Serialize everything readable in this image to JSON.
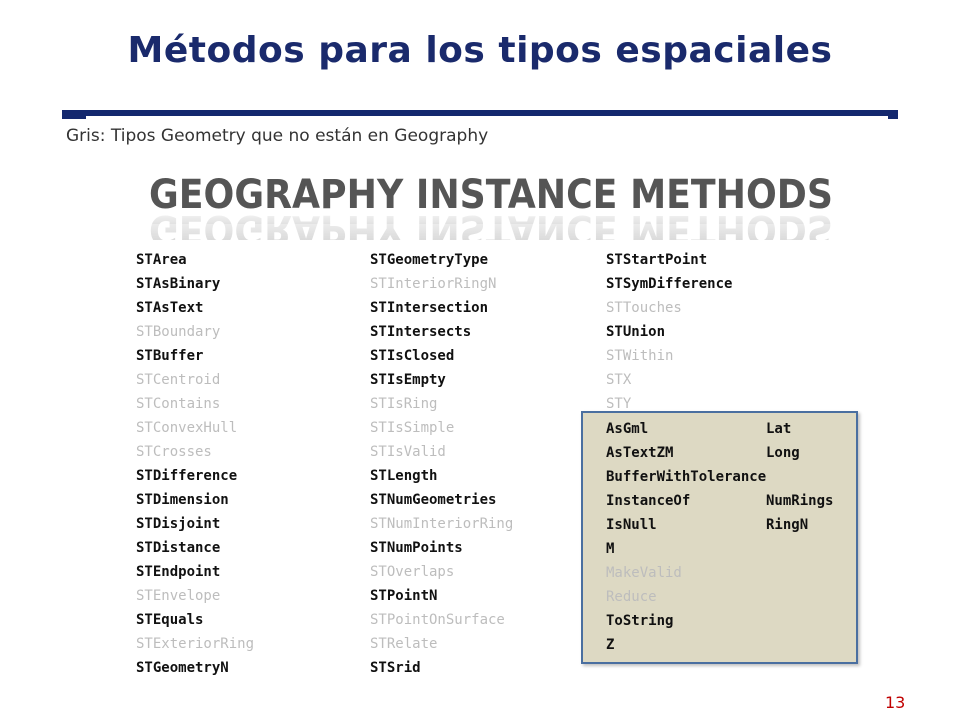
{
  "slide": {
    "title": "Métodos para los tipos espaciales",
    "subtitle": "Gris: Tipos Geometry que no están en Geography",
    "banner_text": "GEOGRAPHY INSTANCE METHODS",
    "page_number": "13"
  },
  "columns": [
    [
      {
        "name": "STArea",
        "supported": true
      },
      {
        "name": "STAsBinary",
        "supported": true
      },
      {
        "name": "STAsText",
        "supported": true
      },
      {
        "name": "STBoundary",
        "supported": false
      },
      {
        "name": "STBuffer",
        "supported": true
      },
      {
        "name": "STCentroid",
        "supported": false
      },
      {
        "name": "STContains",
        "supported": false
      },
      {
        "name": "STConvexHull",
        "supported": false
      },
      {
        "name": "STCrosses",
        "supported": false
      },
      {
        "name": "STDifference",
        "supported": true
      },
      {
        "name": "STDimension",
        "supported": true
      },
      {
        "name": "STDisjoint",
        "supported": true
      },
      {
        "name": "STDistance",
        "supported": true
      },
      {
        "name": "STEndpoint",
        "supported": true
      },
      {
        "name": "STEnvelope",
        "supported": false
      },
      {
        "name": "STEquals",
        "supported": true
      },
      {
        "name": "STExteriorRing",
        "supported": false
      },
      {
        "name": "STGeometryN",
        "supported": true
      }
    ],
    [
      {
        "name": "STGeometryType",
        "supported": true
      },
      {
        "name": "STInteriorRingN",
        "supported": false
      },
      {
        "name": "STIntersection",
        "supported": true
      },
      {
        "name": "STIntersects",
        "supported": true
      },
      {
        "name": "STIsClosed",
        "supported": true
      },
      {
        "name": "STIsEmpty",
        "supported": true
      },
      {
        "name": "STIsRing",
        "supported": false
      },
      {
        "name": "STIsSimple",
        "supported": false
      },
      {
        "name": "STIsValid",
        "supported": false
      },
      {
        "name": "STLength",
        "supported": true
      },
      {
        "name": "STNumGeometries",
        "supported": true
      },
      {
        "name": "STNumInteriorRing",
        "supported": false
      },
      {
        "name": "STNumPoints",
        "supported": true
      },
      {
        "name": "STOverlaps",
        "supported": false
      },
      {
        "name": "STPointN",
        "supported": true
      },
      {
        "name": "STPointOnSurface",
        "supported": false
      },
      {
        "name": "STRelate",
        "supported": false
      },
      {
        "name": "STSrid",
        "supported": true
      }
    ],
    [
      {
        "name": "STStartPoint",
        "supported": true
      },
      {
        "name": "STSymDifference",
        "supported": true
      },
      {
        "name": "STTouches",
        "supported": false
      },
      {
        "name": "STUnion",
        "supported": true
      },
      {
        "name": "STWithin",
        "supported": false
      },
      {
        "name": "STX",
        "supported": false
      },
      {
        "name": "STY",
        "supported": false
      }
    ]
  ],
  "extended_box": {
    "left": [
      {
        "name": "AsGml",
        "supported": true
      },
      {
        "name": "AsTextZM",
        "supported": true
      },
      {
        "name": "BufferWithTolerance",
        "supported": true
      },
      {
        "name": "InstanceOf",
        "supported": true
      },
      {
        "name": "IsNull",
        "supported": true
      },
      {
        "name": "M",
        "supported": true
      },
      {
        "name": "MakeValid",
        "supported": false
      },
      {
        "name": "Reduce",
        "supported": false
      },
      {
        "name": "ToString",
        "supported": true
      },
      {
        "name": "Z",
        "supported": true
      }
    ],
    "right": [
      {
        "name": "Lat",
        "supported": true
      },
      {
        "name": "Long",
        "supported": true
      },
      {
        "name": "",
        "supported": true
      },
      {
        "name": "NumRings",
        "supported": true
      },
      {
        "name": "RingN",
        "supported": true
      }
    ]
  },
  "colors": {
    "title": "#1a2a6c",
    "rule": "#14286e",
    "banner_fill": "#555555",
    "supported_text": "#111111",
    "unsupported_text": "#bdbdbd",
    "box_fill": "#ddd9c3",
    "box_border": "#4a6fa0",
    "page_number": "#c00000"
  }
}
